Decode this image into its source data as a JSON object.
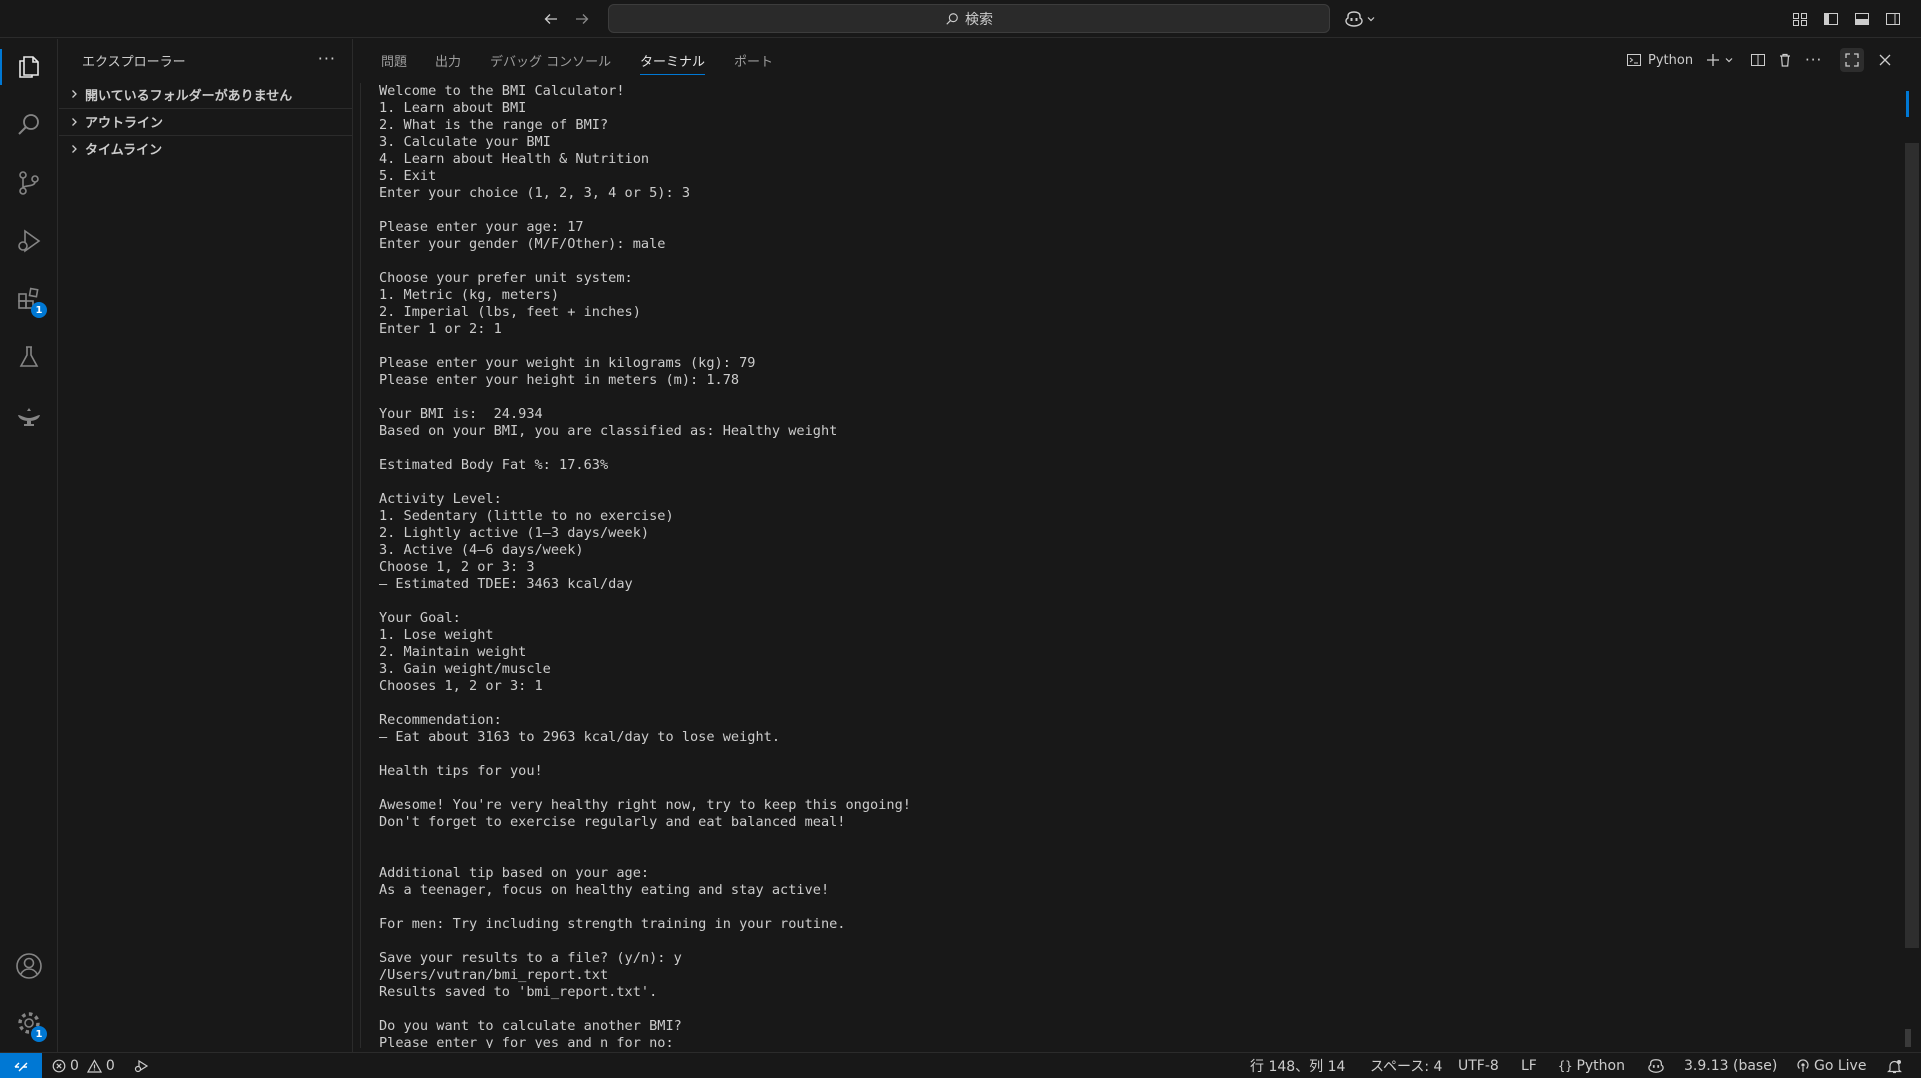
{
  "titlebar": {
    "search_placeholder": "検索"
  },
  "activity_bar": {
    "items": [
      {
        "icon": "files-icon",
        "label": "Explorer"
      },
      {
        "icon": "search-icon",
        "label": "Search"
      },
      {
        "icon": "source-control-icon",
        "label": "Source Control"
      },
      {
        "icon": "run-debug-icon",
        "label": "Run and Debug"
      },
      {
        "icon": "extensions-icon",
        "label": "Extensions",
        "badge": "1"
      },
      {
        "icon": "testing-icon",
        "label": "Testing"
      },
      {
        "icon": "jupyter-icon",
        "label": "Jupyter"
      },
      {
        "icon": "account-icon",
        "label": "Accounts"
      },
      {
        "icon": "settings-gear-icon",
        "label": "Manage",
        "badge": "1"
      }
    ]
  },
  "sidebar": {
    "title": "エクスプローラー",
    "more": "···",
    "sections": [
      {
        "label": "開いているフォルダーがありません"
      },
      {
        "label": "アウトライン"
      },
      {
        "label": "タイムライン"
      }
    ]
  },
  "panel": {
    "tabs": [
      {
        "label": "問題"
      },
      {
        "label": "出力"
      },
      {
        "label": "デバッグ コンソール"
      },
      {
        "label": "ターミナル",
        "active": true
      },
      {
        "label": "ポート"
      }
    ],
    "terminal_name": "Python"
  },
  "terminal_lines": [
    "Welcome to the BMI Calculator!",
    "1. Learn about BMI",
    "2. What is the range of BMI?",
    "3. Calculate your BMI",
    "4. Learn about Health & Nutrition",
    "5. Exit",
    "Enter your choice (1, 2, 3, 4 or 5): 3",
    "",
    "Please enter your age: 17",
    "Enter your gender (M/F/Other): male",
    "",
    "Choose your prefer unit system:",
    "1. Metric (kg, meters)",
    "2. Imperial (lbs, feet + inches)",
    "Enter 1 or 2: 1",
    "",
    "Please enter your weight in kilograms (kg): 79",
    "Please enter your height in meters (m): 1.78",
    "",
    "Your BMI is:  24.934",
    "Based on your BMI, you are classified as: Healthy weight",
    "",
    "Estimated Body Fat %: 17.63%",
    "",
    "Activity Level:",
    "1. Sedentary (little to no exercise)",
    "2. Lightly active (1–3 days/week)",
    "3. Active (4–6 days/week)",
    "Choose 1, 2 or 3: 3",
    "– Estimated TDEE: 3463 kcal/day",
    "",
    "Your Goal:",
    "1. Lose weight",
    "2. Maintain weight",
    "3. Gain weight/muscle",
    "Chooses 1, 2 or 3: 1",
    "",
    "Recommendation:",
    "– Eat about 3163 to 2963 kcal/day to lose weight.",
    "",
    "Health tips for you!",
    "",
    "Awesome! You're very healthy right now, try to keep this ongoing!",
    "Don't forget to exercise regularly and eat balanced meal!",
    "",
    "",
    "Additional tip based on your age:",
    "As a teenager, focus on healthy eating and stay active!",
    "",
    "For men: Try including strength training in your routine.",
    "",
    "Save your results to a file? (y/n): y",
    "/Users/vutran/bmi_report.txt",
    "Results saved to 'bmi_report.txt'.",
    "",
    "Do you want to calculate another BMI?",
    "Please enter y for yes and n for no:"
  ],
  "statusbar": {
    "errors": "0",
    "warnings": "0",
    "cursor_position": "行 148、列 14",
    "indentation": "スペース: 4",
    "encoding": "UTF-8",
    "eol": "LF",
    "language": "Python",
    "interpreter": "3.9.13 (base)",
    "go_live": "Go Live"
  },
  "colors": {
    "background": "#181818",
    "accent": "#0078d4",
    "text": "#cccccc",
    "border": "#2b2b2b"
  }
}
